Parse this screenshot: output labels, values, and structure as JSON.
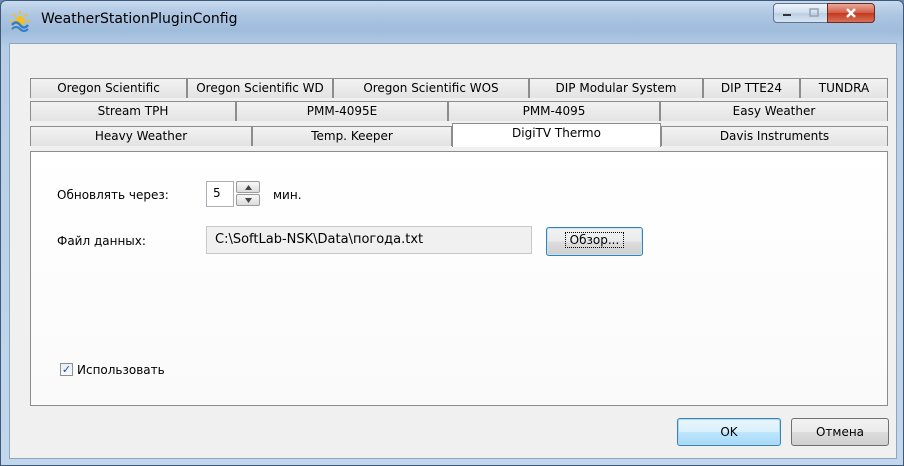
{
  "window": {
    "title": "WeatherStationPluginConfig",
    "icon": "weather-station-app-icon",
    "controls": {
      "minimize": "minimize-icon",
      "maximize": "maximize-icon",
      "close": "close-icon"
    }
  },
  "tabs": {
    "row1": [
      "Oregon Scientific",
      "Oregon Scientific WD",
      "Oregon Scientific WOS",
      "DIP Modular System",
      "DIP TTE24",
      "TUNDRA"
    ],
    "row2": [
      "Stream TPH",
      "PMM-4095E",
      "PMM-4095",
      "Easy Weather"
    ],
    "row3": [
      "Heavy Weather",
      "Temp. Keeper",
      "DigiTV Thermo",
      "Davis Instruments"
    ],
    "active": "DigiTV Thermo"
  },
  "form": {
    "update_label": "Обновлять через:",
    "update_value": "5",
    "update_unit": "мин.",
    "file_label": "Файл данных:",
    "file_path": "C:\\SoftLab-NSK\\Data\\погода.txt",
    "browse_label": "Обзор...",
    "use_label": "Использовать",
    "use_checked": true
  },
  "buttons": {
    "ok": "OK",
    "cancel": "Отмена"
  }
}
